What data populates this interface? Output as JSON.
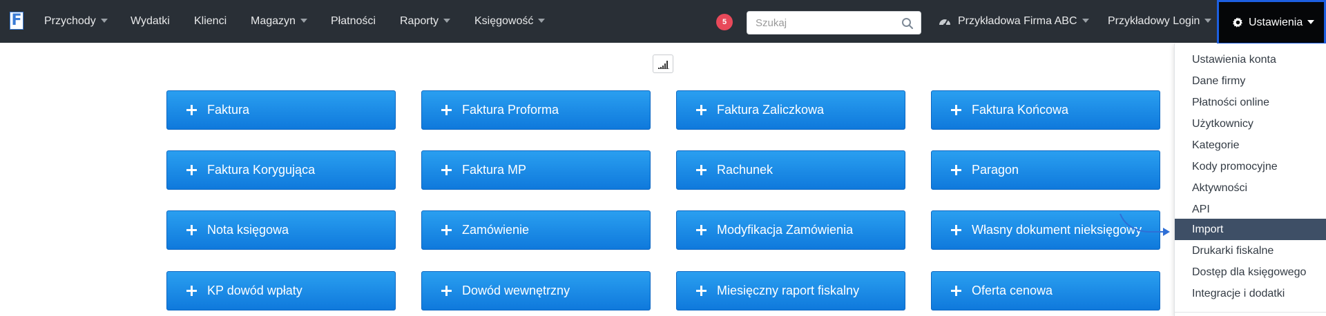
{
  "navbar": {
    "logo_letter": "F",
    "items": [
      {
        "label": "Przychody",
        "dropdown": true
      },
      {
        "label": "Wydatki",
        "dropdown": false
      },
      {
        "label": "Klienci",
        "dropdown": false
      },
      {
        "label": "Magazyn",
        "dropdown": true
      },
      {
        "label": "Płatności",
        "dropdown": false
      },
      {
        "label": "Raporty",
        "dropdown": true
      },
      {
        "label": "Księgowość",
        "dropdown": true
      }
    ],
    "notification_count": "5",
    "search_placeholder": "Szukaj",
    "company": "Przykładowa Firma ABC",
    "login": "Przykładowy Login",
    "settings": "Ustawienia",
    "background_color": "#292f36",
    "settings_highlight_color": "#1d5fe0"
  },
  "documents": [
    [
      "Faktura",
      "Faktura Proforma",
      "Faktura Zaliczkowa",
      "Faktura Końcowa"
    ],
    [
      "Faktura Korygująca",
      "Faktura MP",
      "Rachunek",
      "Paragon"
    ],
    [
      "Nota księgowa",
      "Zamówienie",
      "Modyfikacja Zamówienia",
      "Własny dokument nieksięgowy"
    ],
    [
      "KP dowód wpłaty",
      "Dowód wewnętrzny",
      "Miesięczny raport fiskalny",
      "Oferta cenowa"
    ]
  ],
  "button_color": "#1a8ae6",
  "settings_menu": {
    "items": [
      "Ustawienia konta",
      "Dane firmy",
      "Płatności online",
      "Użytkownicy",
      "Kategorie",
      "Kody promocyjne",
      "Aktywności",
      "API",
      "Import",
      "Drukarki fiskalne",
      "Dostęp dla księgowego",
      "Integracje i dodatki"
    ],
    "active_item": "Import",
    "active_color": "#3e4f66"
  },
  "icons": {
    "search": "search-icon",
    "company": "gauge-icon",
    "settings": "gear-icon",
    "toggle": "signal-bars-icon",
    "add": "plus-icon",
    "pointer": "curved-arrow-icon"
  }
}
